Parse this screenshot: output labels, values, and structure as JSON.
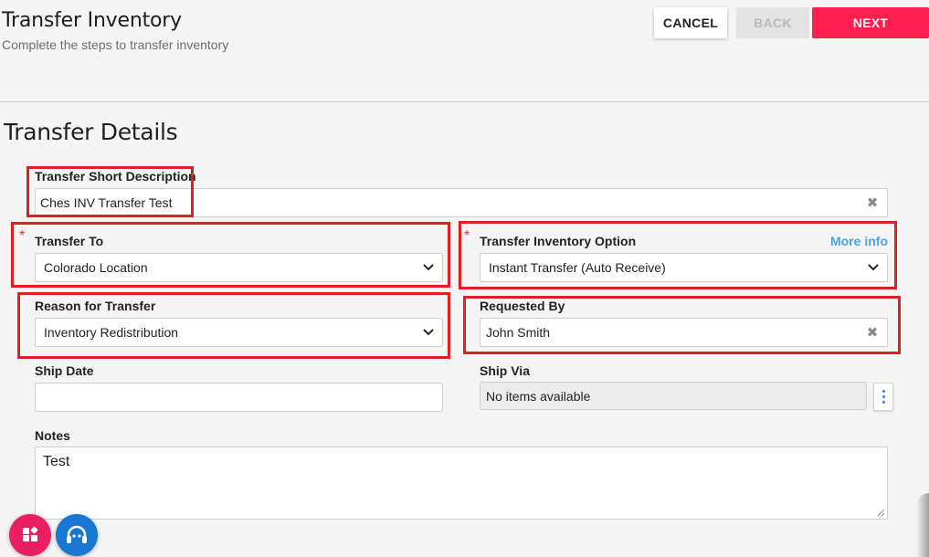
{
  "header": {
    "title": "Transfer Inventory",
    "subtitle": "Complete the steps to transfer inventory",
    "cancel_label": "CANCEL",
    "back_label": "BACK",
    "next_label": "NEXT"
  },
  "section": {
    "title": "Transfer Details"
  },
  "fields": {
    "short_description": {
      "label": "Transfer Short Description",
      "value": "Ches INV Transfer Test",
      "clear_icon": "✖"
    },
    "transfer_to": {
      "label": "Transfer To",
      "required": "*",
      "value": "Colorado Location"
    },
    "inventory_option": {
      "label": "Transfer Inventory Option",
      "required": "*",
      "more_info": "More info",
      "value": "Instant Transfer (Auto Receive)"
    },
    "reason": {
      "label": "Reason for Transfer",
      "value": "Inventory Redistribution"
    },
    "requested_by": {
      "label": "Requested By",
      "value": "John Smith",
      "clear_icon": "✖"
    },
    "ship_date": {
      "label": "Ship Date",
      "value": ""
    },
    "ship_via": {
      "label": "Ship Via",
      "value": "No items available"
    },
    "notes": {
      "label": "Notes",
      "value": "Test"
    }
  },
  "colors": {
    "accent": "#ff1e50",
    "link": "#4aa3ea",
    "highlight": "#e02020",
    "fab_pink": "#e91e63",
    "fab_blue": "#1976d2"
  },
  "icons": {
    "clear": "x-icon",
    "dropdown": "chevron-down-icon",
    "menu": "kebab-menu-icon",
    "apps": "apps-icon",
    "support": "support-headset-icon"
  }
}
